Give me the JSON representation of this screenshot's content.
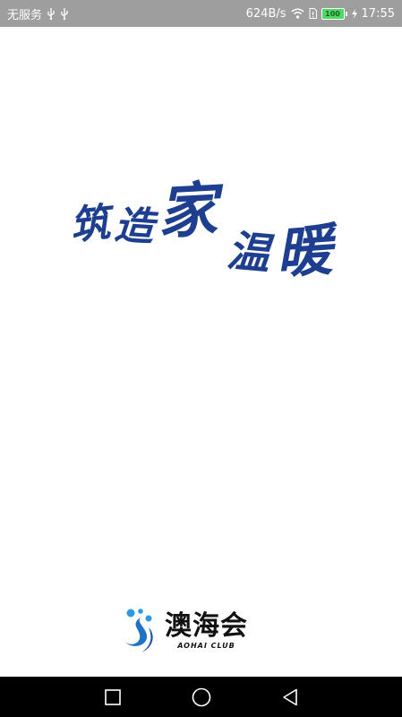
{
  "status_bar": {
    "carrier": "无服务",
    "network_speed": "624B/s",
    "battery_level": "100",
    "time": "17:55",
    "background_color": "#9e9e9e",
    "icons": [
      "usb-icon",
      "usb-icon",
      "wifi-icon",
      "sim-icon",
      "battery-icon",
      "charging-icon"
    ]
  },
  "splash": {
    "slogan": {
      "chars": [
        "筑",
        "造",
        "家",
        "温",
        "暖"
      ],
      "color": "#1e3f8f"
    },
    "brand": {
      "name": "澳海会",
      "subtitle": "AOHAI CLUB",
      "mark_icon": "aohai-logo-icon",
      "mark_color": "#1e73c8"
    }
  },
  "nav_bar": {
    "buttons": [
      "recents-square-icon",
      "home-circle-icon",
      "back-triangle-icon"
    ],
    "background_color": "#000000"
  }
}
